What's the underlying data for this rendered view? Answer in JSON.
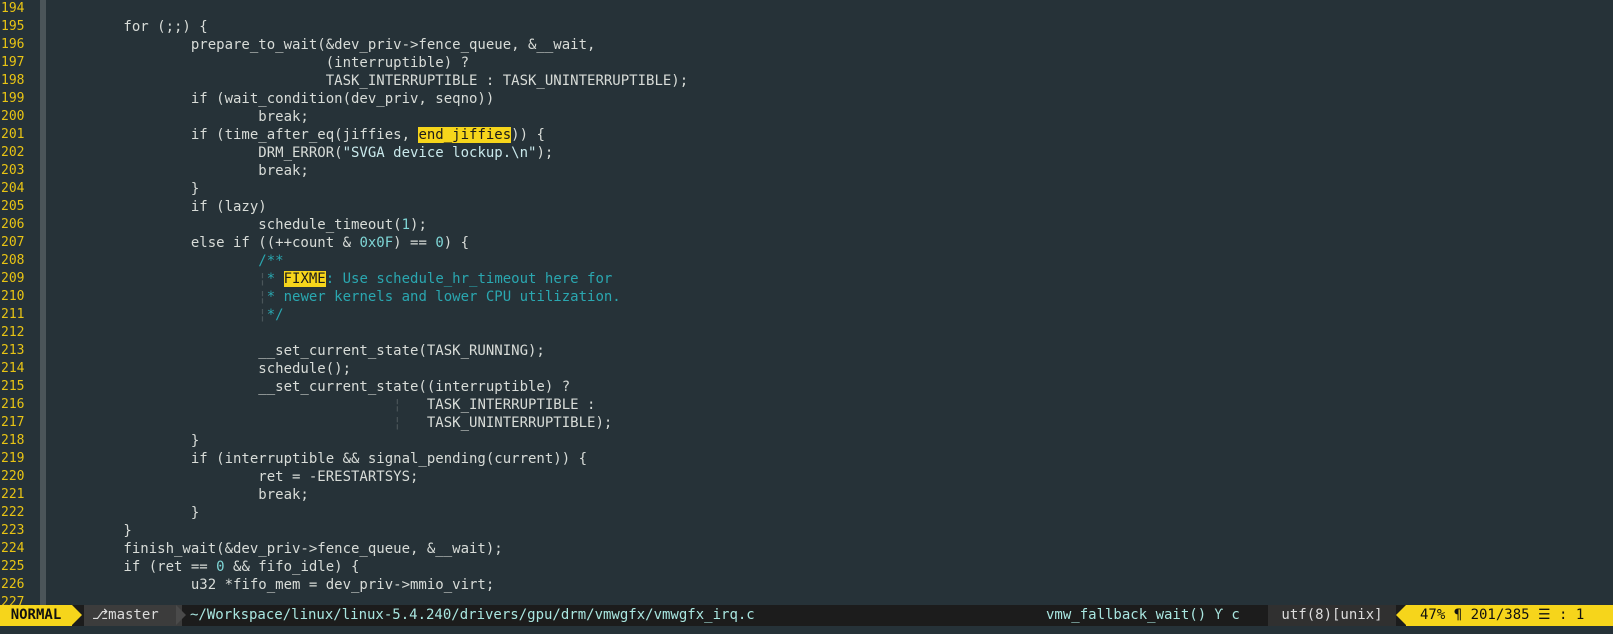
{
  "colors": {
    "background": "#263238",
    "line_number": "#e8c414",
    "highlight": "#f6d51b",
    "comment": "#2aa7b0",
    "number": "#7fd6d6",
    "statusline_mode_bg": "#f6d51b"
  },
  "lines": [
    {
      "n": "194",
      "segs": []
    },
    {
      "n": "195",
      "segs": [
        {
          "t": "        for (;;) {"
        }
      ]
    },
    {
      "n": "196",
      "segs": [
        {
          "t": "                prepare_to_wait(&dev_priv->fence_queue, &__wait,"
        }
      ]
    },
    {
      "n": "197",
      "segs": [
        {
          "t": "                                (interruptible) ?"
        }
      ]
    },
    {
      "n": "198",
      "segs": [
        {
          "t": "                                TASK_INTERRUPTIBLE : TASK_UNINTERRUPTIBLE);"
        }
      ]
    },
    {
      "n": "199",
      "segs": [
        {
          "t": "                if (wait_condition(dev_priv, seqno))"
        }
      ]
    },
    {
      "n": "200",
      "segs": [
        {
          "t": "                        break;"
        }
      ]
    },
    {
      "n": "201",
      "segs": [
        {
          "t": "                if (time_after_eq(jiffies, "
        },
        {
          "t": "end_jiffies",
          "c": "hl"
        },
        {
          "t": ")) {"
        }
      ]
    },
    {
      "n": "202",
      "segs": [
        {
          "t": "                        DRM_ERROR("
        },
        {
          "t": "\"SVGA device lockup.\\n\"",
          "c": "str"
        },
        {
          "t": ");"
        }
      ]
    },
    {
      "n": "203",
      "segs": [
        {
          "t": "                        break;"
        }
      ]
    },
    {
      "n": "204",
      "segs": [
        {
          "t": "                }"
        }
      ]
    },
    {
      "n": "205",
      "segs": [
        {
          "t": "                if (lazy)"
        }
      ]
    },
    {
      "n": "206",
      "segs": [
        {
          "t": "                        schedule_timeout("
        },
        {
          "t": "1",
          "c": "num"
        },
        {
          "t": ");"
        }
      ]
    },
    {
      "n": "207",
      "segs": [
        {
          "t": "                else if ((++count & "
        },
        {
          "t": "0x0F",
          "c": "num"
        },
        {
          "t": ") == "
        },
        {
          "t": "0",
          "c": "num"
        },
        {
          "t": ") {"
        }
      ]
    },
    {
      "n": "208",
      "segs": [
        {
          "t": "                        "
        },
        {
          "t": "/**",
          "c": "cmt"
        }
      ]
    },
    {
      "n": "209",
      "segs": [
        {
          "t": "                        "
        },
        {
          "t": "¦",
          "c": "guide"
        },
        {
          "t": "* ",
          "c": "cmt"
        },
        {
          "t": "FIXME",
          "c": "hl"
        },
        {
          "t": ": Use schedule_hr_timeout here for",
          "c": "cmt"
        }
      ]
    },
    {
      "n": "210",
      "segs": [
        {
          "t": "                        "
        },
        {
          "t": "¦",
          "c": "guide"
        },
        {
          "t": "* newer kernels and lower CPU utilization.",
          "c": "cmt"
        }
      ]
    },
    {
      "n": "211",
      "segs": [
        {
          "t": "                        "
        },
        {
          "t": "¦",
          "c": "guide"
        },
        {
          "t": "*/",
          "c": "cmt"
        }
      ]
    },
    {
      "n": "212",
      "segs": []
    },
    {
      "n": "213",
      "segs": [
        {
          "t": "                        __set_current_state(TASK_RUNNING);"
        }
      ]
    },
    {
      "n": "214",
      "segs": [
        {
          "t": "                        schedule();"
        }
      ]
    },
    {
      "n": "215",
      "segs": [
        {
          "t": "                        __set_current_state((interruptible) ?"
        }
      ]
    },
    {
      "n": "216",
      "segs": [
        {
          "t": "                                        "
        },
        {
          "t": "¦",
          "c": "guide"
        },
        {
          "t": "   TASK_INTERRUPTIBLE :"
        }
      ]
    },
    {
      "n": "217",
      "segs": [
        {
          "t": "                                        "
        },
        {
          "t": "¦",
          "c": "guide"
        },
        {
          "t": "   TASK_UNINTERRUPTIBLE);"
        }
      ]
    },
    {
      "n": "218",
      "segs": [
        {
          "t": "                }"
        }
      ]
    },
    {
      "n": "219",
      "segs": [
        {
          "t": "                if (interruptible && signal_pending(current)) {"
        }
      ]
    },
    {
      "n": "220",
      "segs": [
        {
          "t": "                        ret = -ERESTARTSYS;"
        }
      ]
    },
    {
      "n": "221",
      "segs": [
        {
          "t": "                        break;"
        }
      ]
    },
    {
      "n": "222",
      "segs": [
        {
          "t": "                }"
        }
      ]
    },
    {
      "n": "223",
      "segs": [
        {
          "t": "        }"
        }
      ]
    },
    {
      "n": "224",
      "segs": [
        {
          "t": "        finish_wait(&dev_priv->fence_queue, &__wait);"
        }
      ]
    },
    {
      "n": "225",
      "segs": [
        {
          "t": "        if (ret == "
        },
        {
          "t": "0",
          "c": "num"
        },
        {
          "t": " && fifo_idle) {"
        }
      ]
    },
    {
      "n": "226",
      "segs": [
        {
          "t": "                u32 *fifo_mem = dev_priv->mmio_virt;"
        }
      ]
    },
    {
      "n": "227",
      "segs": []
    }
  ],
  "statusline": {
    "mode": "NORMAL",
    "branch_icon": "⎇",
    "branch": "master",
    "filepath": "~/Workspace/linux/linux-5.4.240/drivers/gpu/drm/vmwgfx/vmwgfx_irq.c",
    "function": "vmw_fallback_wait() Ƴ c",
    "encoding": "utf(8)[unix]",
    "position": "47% ¶ 201/385 ☰ : 1"
  }
}
